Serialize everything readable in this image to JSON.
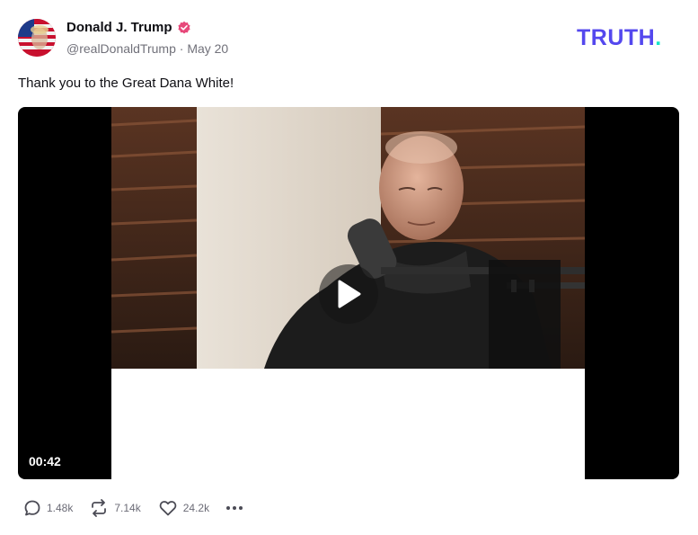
{
  "post": {
    "author_name": "Donald J. Trump",
    "handle": "@realDonaldTrump",
    "separator": "·",
    "date": "May 20",
    "text": "Thank you to the Great Dana White!"
  },
  "brand": {
    "logo_text": "TRUTH",
    "logo_dot": ".",
    "primary_color": "#5448ee",
    "dot_color": "#17e6c8"
  },
  "video": {
    "duration": "00:42"
  },
  "actions": {
    "replies": "1.48k",
    "retruths": "7.14k",
    "likes": "24.2k"
  },
  "icons": {
    "verified": "verified-badge-icon",
    "reply": "reply-bubble-icon",
    "retruth": "retruth-arrows-icon",
    "like": "heart-icon",
    "more": "more-dots-icon",
    "play": "play-icon"
  }
}
